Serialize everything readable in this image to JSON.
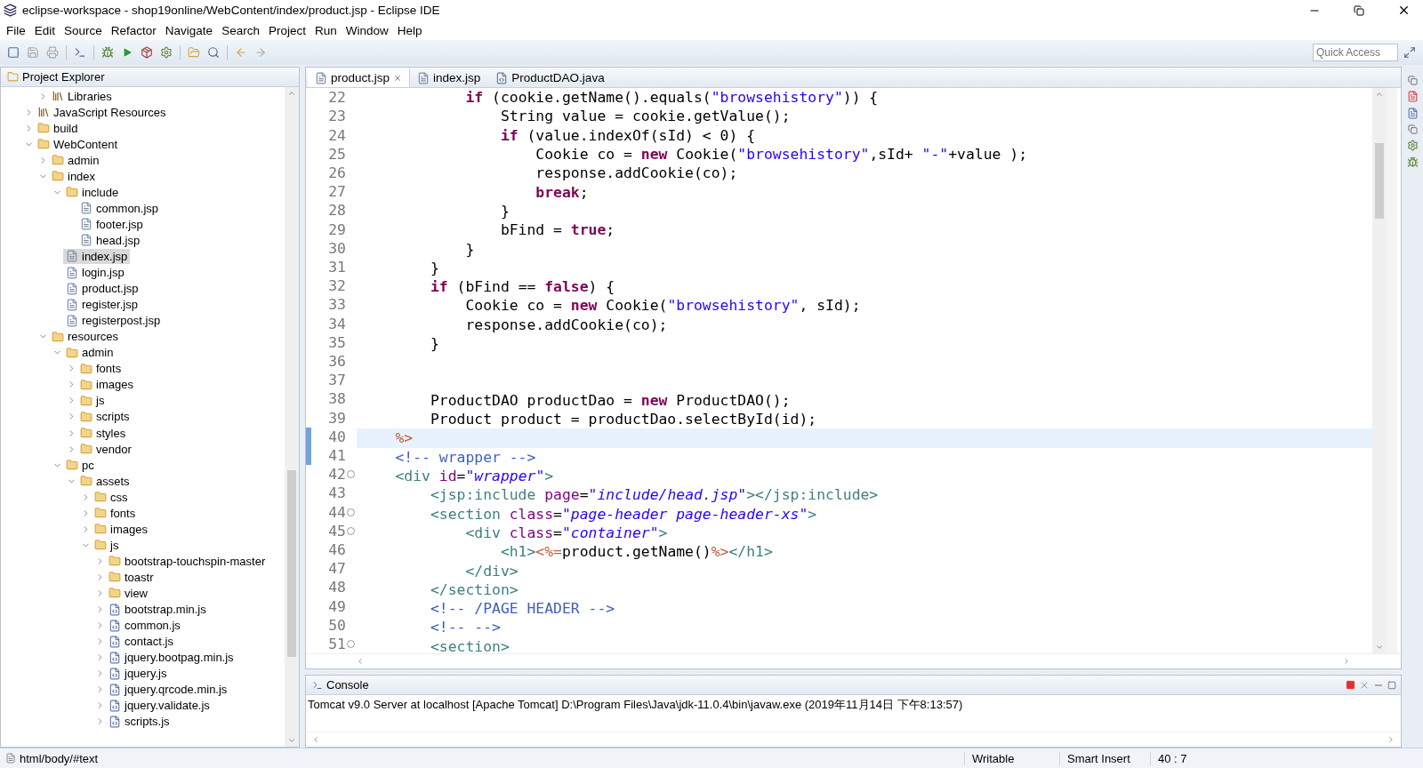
{
  "window": {
    "title": "eclipse-workspace - shop19online/WebContent/index/product.jsp - Eclipse IDE"
  },
  "menu": [
    "File",
    "Edit",
    "Source",
    "Refactor",
    "Navigate",
    "Search",
    "Project",
    "Run",
    "Window",
    "Help"
  ],
  "quick_access": {
    "placeholder": "Quick Access"
  },
  "explorer": {
    "title": "Project Explorer",
    "tree": [
      {
        "children": [
          {
            "label": "Libraries",
            "kind": "library",
            "expanded": false
          }
        ]
      },
      {
        "label": "JavaScript Resources",
        "kind": "library",
        "expanded": false
      },
      {
        "label": "build",
        "kind": "folder",
        "expanded": false
      },
      {
        "label": "WebContent",
        "kind": "folder",
        "expanded": true,
        "children": [
          {
            "label": "admin",
            "kind": "folder",
            "expanded": false
          },
          {
            "label": "index",
            "kind": "folder",
            "expanded": true,
            "children": [
              {
                "label": "include",
                "kind": "folder",
                "expanded": true,
                "children": [
                  {
                    "label": "common.jsp",
                    "kind": "page"
                  },
                  {
                    "label": "footer.jsp",
                    "kind": "page"
                  },
                  {
                    "label": "head.jsp",
                    "kind": "page"
                  }
                ]
              },
              {
                "label": "index.jsp",
                "kind": "page",
                "selected": true
              },
              {
                "label": "login.jsp",
                "kind": "page",
                "selected": false
              },
              {
                "label": "product.jsp",
                "kind": "page",
                "selected": false
              },
              {
                "label": "register.jsp",
                "kind": "page",
                "selected": false
              },
              {
                "label": "registerpost.jsp",
                "kind": "page",
                "selected": false
              }
            ]
          },
          {
            "label": "resources",
            "kind": "folder",
            "expanded": true,
            "children": [
              {
                "label": "admin",
                "kind": "folder",
                "expanded": true,
                "children": [
                  {
                    "label": "fonts",
                    "kind": "folder",
                    "expanded": false
                  },
                  {
                    "label": "images",
                    "kind": "folder",
                    "expanded": false
                  },
                  {
                    "label": "js",
                    "kind": "folder",
                    "expanded": false
                  },
                  {
                    "label": "scripts",
                    "kind": "folder",
                    "expanded": false
                  },
                  {
                    "label": "styles",
                    "kind": "folder",
                    "expanded": false
                  },
                  {
                    "label": "vendor",
                    "kind": "folder",
                    "expanded": false
                  }
                ]
              },
              {
                "label": "pc",
                "kind": "folder",
                "expanded": true,
                "children": [
                  {
                    "label": "assets",
                    "kind": "folder",
                    "expanded": true,
                    "children": [
                      {
                        "label": "css",
                        "kind": "folder",
                        "expanded": false
                      },
                      {
                        "label": "fonts",
                        "kind": "folder",
                        "expanded": false
                      },
                      {
                        "label": "images",
                        "kind": "folder",
                        "expanded": false
                      },
                      {
                        "label": "js",
                        "kind": "folder",
                        "expanded": true,
                        "children": [
                          {
                            "label": "bootstrap-touchspin-master",
                            "kind": "folder",
                            "expanded": false
                          },
                          {
                            "label": "toastr",
                            "kind": "folder",
                            "expanded": false
                          },
                          {
                            "label": "view",
                            "kind": "folder",
                            "expanded": false
                          },
                          {
                            "label": "bootstrap.min.js",
                            "kind": "script",
                            "expanded": false
                          },
                          {
                            "label": "common.js",
                            "kind": "script",
                            "expanded": false
                          },
                          {
                            "label": "contact.js",
                            "kind": "script",
                            "expanded": false
                          },
                          {
                            "label": "jquery.bootpag.min.js",
                            "kind": "script",
                            "expanded": false
                          },
                          {
                            "label": "jquery.js",
                            "kind": "script",
                            "expanded": false
                          },
                          {
                            "label": "jquery.qrcode.min.js",
                            "kind": "script",
                            "expanded": false
                          },
                          {
                            "label": "jquery.validate.js",
                            "kind": "script",
                            "expanded": false
                          },
                          {
                            "label": "scripts.js",
                            "kind": "script",
                            "expanded": false
                          }
                        ]
                      }
                    ]
                  }
                ]
              }
            ]
          }
        ]
      }
    ]
  },
  "editor": {
    "tabs": [
      {
        "label": "product.jsp",
        "kind": "page",
        "selected": true
      },
      {
        "label": "index.jsp",
        "kind": "page",
        "selected": false
      },
      {
        "label": "ProductDAO.java",
        "kind": "java",
        "selected": false
      }
    ],
    "lines": [
      {
        "number": "22",
        "tokens": [
          {
            "kind": "kw",
            "text": "            if"
          },
          {
            "kind": "plain",
            "text": " (cookie.getName().equals("
          },
          {
            "kind": "str",
            "text": "\"browsehistory\""
          },
          {
            "kind": "plain",
            "text": ")) {"
          }
        ]
      },
      {
        "number": "23",
        "tokens": [
          {
            "kind": "plain",
            "text": "                String value = cookie.getValue();"
          }
        ]
      },
      {
        "number": "24",
        "tokens": [
          {
            "kind": "kw",
            "text": "                if"
          },
          {
            "kind": "plain",
            "text": " (value.indexOf(sId) < 0) {"
          }
        ]
      },
      {
        "number": "25",
        "tokens": [
          {
            "kind": "plain",
            "text": "                    Cookie co = "
          },
          {
            "kind": "kw",
            "text": "new"
          },
          {
            "kind": "plain",
            "text": " Cookie("
          },
          {
            "kind": "str",
            "text": "\"browsehistory\""
          },
          {
            "kind": "plain",
            "text": ",sId+ "
          },
          {
            "kind": "str",
            "text": "\"-\""
          },
          {
            "kind": "plain",
            "text": "+value );"
          }
        ]
      },
      {
        "number": "26",
        "tokens": [
          {
            "kind": "plain",
            "text": "                    response.addCookie(co);"
          }
        ]
      },
      {
        "number": "27",
        "tokens": [
          {
            "kind": "kw",
            "text": "                    break"
          },
          {
            "kind": "plain",
            "text": ";"
          }
        ]
      },
      {
        "number": "28",
        "tokens": [
          {
            "kind": "plain",
            "text": "                }"
          }
        ]
      },
      {
        "number": "29",
        "tokens": [
          {
            "kind": "plain",
            "text": "                bFind = "
          },
          {
            "kind": "kw",
            "text": "true"
          },
          {
            "kind": "plain",
            "text": ";"
          }
        ]
      },
      {
        "number": "30",
        "tokens": [
          {
            "kind": "plain",
            "text": "            }"
          }
        ]
      },
      {
        "number": "31",
        "tokens": [
          {
            "kind": "plain",
            "text": "        }"
          }
        ]
      },
      {
        "number": "32",
        "tokens": [
          {
            "kind": "kw",
            "text": "        if"
          },
          {
            "kind": "plain",
            "text": " (bFind == "
          },
          {
            "kind": "kw",
            "text": "false"
          },
          {
            "kind": "plain",
            "text": ") {"
          }
        ]
      },
      {
        "number": "33",
        "tokens": [
          {
            "kind": "plain",
            "text": "            Cookie co = "
          },
          {
            "kind": "kw",
            "text": "new"
          },
          {
            "kind": "plain",
            "text": " Cookie("
          },
          {
            "kind": "str",
            "text": "\"browsehistory\""
          },
          {
            "kind": "plain",
            "text": ", sId);"
          }
        ]
      },
      {
        "number": "34",
        "tokens": [
          {
            "kind": "plain",
            "text": "            response.addCookie(co);"
          }
        ]
      },
      {
        "number": "35",
        "tokens": [
          {
            "kind": "plain",
            "text": "        }"
          }
        ]
      },
      {
        "number": "36"
      },
      {
        "number": "37"
      },
      {
        "number": "38",
        "tokens": [
          {
            "kind": "plain",
            "text": "        ProductDAO productDao = "
          },
          {
            "kind": "kw",
            "text": "new"
          },
          {
            "kind": "plain",
            "text": " ProductDAO();"
          }
        ]
      },
      {
        "number": "39",
        "tokens": [
          {
            "kind": "plain",
            "text": "        Product product = productDao.selectById(id);"
          }
        ]
      },
      {
        "number": "40",
        "current": true,
        "changed": true,
        "tokens": [
          {
            "kind": "jsp",
            "text": "    %>"
          }
        ]
      },
      {
        "number": "41",
        "changed": true,
        "tokens": [
          {
            "kind": "cmt",
            "text": "    <!-- wrapper -->"
          }
        ]
      },
      {
        "number": "42",
        "fold": true,
        "tokens": [
          {
            "kind": "tag",
            "text": "    <div "
          },
          {
            "kind": "attr",
            "text": "id"
          },
          {
            "kind": "plain",
            "text": "="
          },
          {
            "kind": "val",
            "text": "\"wrapper\""
          },
          {
            "kind": "tag",
            "text": ">"
          }
        ]
      },
      {
        "number": "43",
        "tokens": [
          {
            "kind": "tag",
            "text": "        <jsp:include "
          },
          {
            "kind": "attr",
            "text": "page"
          },
          {
            "kind": "plain",
            "text": "="
          },
          {
            "kind": "val",
            "text": "\"include/head.jsp\""
          },
          {
            "kind": "tag",
            "text": "></jsp:include>"
          }
        ]
      },
      {
        "number": "44",
        "fold": true,
        "tokens": [
          {
            "kind": "tag",
            "text": "        <section "
          },
          {
            "kind": "attr",
            "text": "class"
          },
          {
            "kind": "plain",
            "text": "="
          },
          {
            "kind": "val",
            "text": "\"page-header page-header-xs\""
          },
          {
            "kind": "tag",
            "text": ">"
          }
        ]
      },
      {
        "number": "45",
        "fold": true,
        "tokens": [
          {
            "kind": "tag",
            "text": "            <div "
          },
          {
            "kind": "attr",
            "text": "class"
          },
          {
            "kind": "plain",
            "text": "="
          },
          {
            "kind": "val",
            "text": "\"container\""
          },
          {
            "kind": "tag",
            "text": ">"
          }
        ]
      },
      {
        "number": "46",
        "tokens": [
          {
            "kind": "tag",
            "text": "                <h1>"
          },
          {
            "kind": "jsp",
            "text": "<%="
          },
          {
            "kind": "plain",
            "text": "product.getName()"
          },
          {
            "kind": "jsp",
            "text": "%>"
          },
          {
            "kind": "tag",
            "text": "</h1>"
          }
        ]
      },
      {
        "number": "47",
        "tokens": [
          {
            "kind": "tag",
            "text": "            </div>"
          }
        ]
      },
      {
        "number": "48",
        "tokens": [
          {
            "kind": "tag",
            "text": "        </section>"
          }
        ]
      },
      {
        "number": "49",
        "tokens": [
          {
            "kind": "cmt",
            "text": "        <!-- /PAGE HEADER -->"
          }
        ]
      },
      {
        "number": "50",
        "tokens": [
          {
            "kind": "cmt",
            "text": "        <!-- -->"
          }
        ]
      },
      {
        "number": "51",
        "fold": true,
        "tokens": [
          {
            "kind": "tag",
            "text": "        <section>"
          }
        ]
      }
    ]
  },
  "console": {
    "title": "Console",
    "output": "Tomcat v9.0 Server at localhost [Apache Tomcat] D:\\Program Files\\Java\\jdk-11.0.4\\bin\\javaw.exe (2019年11月14日 下午8:13:57)"
  },
  "status_bar": {
    "path": "html/body/#text",
    "mode": "Writable",
    "insert": "Smart Insert",
    "position": "40 : 7"
  }
}
